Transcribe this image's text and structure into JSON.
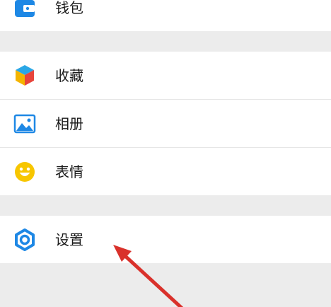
{
  "menu": {
    "wallet": {
      "label": "钱包",
      "icon": "wallet-icon"
    },
    "favorites": {
      "label": "收藏",
      "icon": "cube-icon"
    },
    "album": {
      "label": "相册",
      "icon": "image-icon"
    },
    "stickers": {
      "label": "表情",
      "icon": "smiley-icon"
    },
    "settings": {
      "label": "设置",
      "icon": "gear-icon"
    }
  },
  "colors": {
    "background": "#ececec",
    "row": "#ffffff",
    "accent": "#1e88e5",
    "annotation_arrow": "#d9312b"
  }
}
